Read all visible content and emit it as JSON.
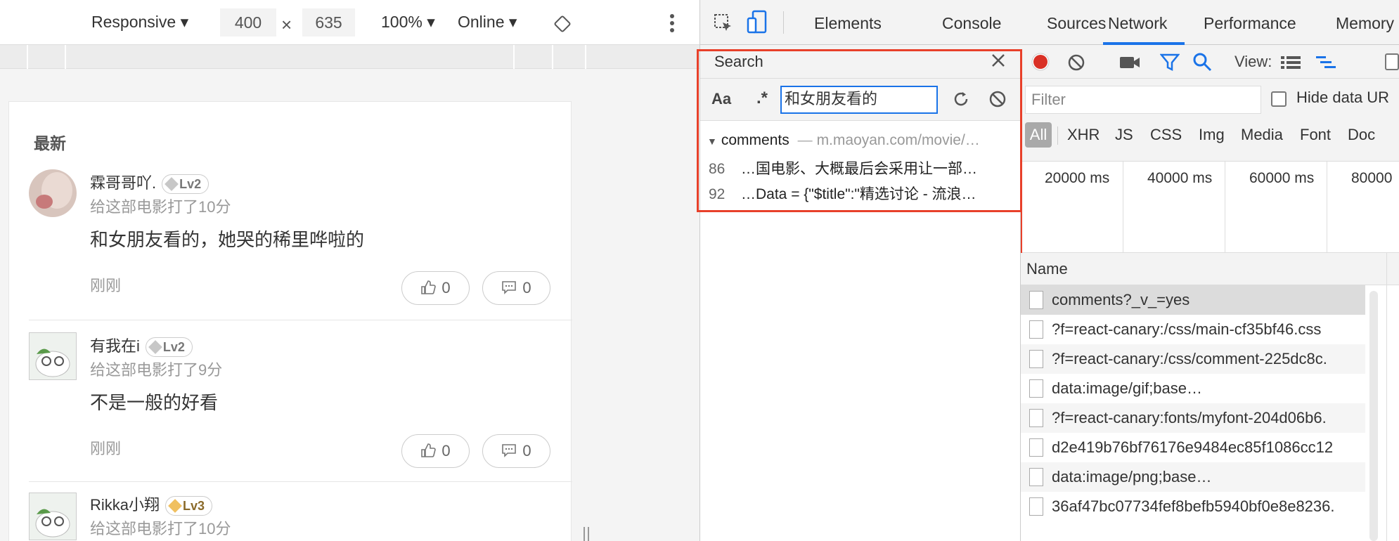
{
  "device_toolbar": {
    "device": "Responsive",
    "width": "400",
    "x_sign": "×",
    "height": "635",
    "zoom": "100%",
    "network": "Online"
  },
  "page": {
    "section_title": "最新",
    "comments": [
      {
        "user": "霖哥哥吖.",
        "level": "Lv2",
        "rating": "给这部电影打了10分",
        "text": "和女朋友看的，她哭的稀里哗啦的",
        "time": "刚刚",
        "likes": "0",
        "replies": "0"
      },
      {
        "user": "有我在i",
        "level": "Lv2",
        "rating": "给这部电影打了9分",
        "text": "不是一般的好看",
        "time": "刚刚",
        "likes": "0",
        "replies": "0"
      },
      {
        "user": "Rikka小翔",
        "level": "Lv3",
        "rating": "给这部电影打了10分"
      }
    ]
  },
  "devtools": {
    "tabs": [
      "Elements",
      "Console",
      "Sources",
      "Network",
      "Performance",
      "Memory"
    ],
    "active_tab": "Network",
    "accent": "#1a73e8",
    "search": {
      "title": "Search",
      "case_label": "Aa",
      "regex_label": ".*",
      "query": "和女朋友看的",
      "result_file": "comments",
      "result_sep": "—",
      "result_url": "m.maoyan.com/movie/…",
      "lines": [
        {
          "num": "86",
          "text": "…国电影、大概最后会采用让一部…"
        },
        {
          "num": "92",
          "text": "…Data = {\"$title\":\"精选讨论 - 流浪…"
        }
      ]
    },
    "network": {
      "view_label": "View:",
      "filter_placeholder": "Filter",
      "hide_data_urls": "Hide data UR",
      "types": [
        "All",
        "XHR",
        "JS",
        "CSS",
        "Img",
        "Media",
        "Font",
        "Doc"
      ],
      "ticks": [
        "20000 ms",
        "40000 ms",
        "60000 ms",
        "80000"
      ],
      "name_header": "Name",
      "requests": [
        "comments?_v_=yes",
        "?f=react-canary:/css/main-cf35bf46.css",
        "?f=react-canary:/css/comment-225dc8c.",
        "data:image/gif;base…",
        "?f=react-canary:fonts/myfont-204d06b6.",
        "d2e419b76bf76176e9484ec85f1086cc12",
        "data:image/png;base…",
        "36af47bc07734fef8befb5940bf0e8e8236."
      ]
    }
  }
}
